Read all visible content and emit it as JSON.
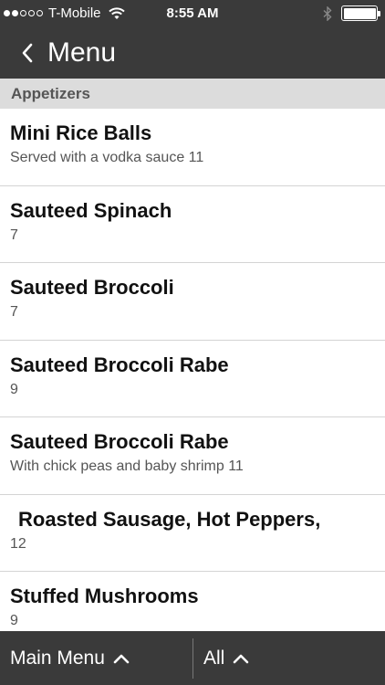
{
  "status_bar": {
    "carrier": "T-Mobile",
    "time": "8:55 AM",
    "signal_bars_filled": 2,
    "signal_bars_total": 5,
    "battery_level": 1.0
  },
  "nav": {
    "title": "Menu",
    "back_icon": "chevron-left-icon"
  },
  "section": {
    "title": "Appetizers"
  },
  "items": [
    {
      "name": "Mini Rice Balls",
      "desc": "Served with a vodka sauce 11"
    },
    {
      "name": "Sauteed Spinach",
      "desc": "7"
    },
    {
      "name": "Sauteed Broccoli",
      "desc": "7"
    },
    {
      "name": "Sauteed Broccoli Rabe",
      "desc": "9"
    },
    {
      "name": "Sauteed Broccoli Rabe",
      "desc": "With chick peas and baby shrimp 11"
    },
    {
      "name": "Roasted Sausage, Hot Peppers,",
      "desc": "12"
    },
    {
      "name": "Stuffed Mushrooms",
      "desc": "9"
    }
  ],
  "bottom_bar": {
    "left_label": "Main Menu",
    "right_label": "All",
    "icon": "chevron-up-icon"
  },
  "colors": {
    "bar_background": "#3a3a3a",
    "section_background": "#dcdcdc",
    "text_primary": "#111111",
    "text_secondary": "#555555"
  }
}
